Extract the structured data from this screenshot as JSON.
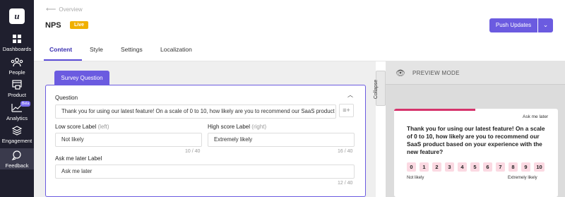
{
  "sidebar": {
    "logo": "u",
    "items": [
      {
        "label": "Dashboards",
        "icon": "grid-icon"
      },
      {
        "label": "People",
        "icon": "people-icon"
      },
      {
        "label": "Product",
        "icon": "product-icon"
      },
      {
        "label": "Analytics",
        "icon": "chart-icon",
        "badge": "Beta"
      },
      {
        "label": "Engagement",
        "icon": "layers-icon"
      },
      {
        "label": "Feedback",
        "icon": "chat-icon",
        "active": true
      }
    ]
  },
  "header": {
    "breadcrumb": "Overview",
    "title": "NPS",
    "status": "Live",
    "push_label": "Push Updates"
  },
  "tabs": [
    "Content",
    "Style",
    "Settings",
    "Localization"
  ],
  "editor": {
    "section_tab": "Survey Question",
    "question_label": "Question",
    "question_value": "Thank you for using our latest feature! On a scale of 0 to 10, how likely are you to recommend our SaaS product based on your experience with the new feature?",
    "low_label": "Low score Label",
    "low_hint": "(left)",
    "low_value": "Not likely",
    "low_count": "10 / 40",
    "high_label": "High score Label",
    "high_hint": "(right)",
    "high_value": "Extremely likely",
    "high_count": "16 / 40",
    "ask_label": "Ask me later Label",
    "ask_value": "Ask me later",
    "ask_count": "12 / 40",
    "collapse_label": "Collapse"
  },
  "preview": {
    "mode_label": "PREVIEW MODE",
    "ask_later": "Ask me later",
    "question_line1": "Thank you for using our latest feature! On a scale",
    "question_line2": "of 0 to 10, how likely are you to recommend our",
    "question_line3": "SaaS product based on your experience with the",
    "question_line4": "new feature?",
    "scale": [
      "0",
      "1",
      "2",
      "3",
      "4",
      "5",
      "6",
      "7",
      "8",
      "9",
      "10"
    ],
    "low": "Not likely",
    "high": "Extremely likely"
  },
  "colors": {
    "accent": "#6b5be0",
    "live": "#f0b000",
    "sidebar": "#1f1f2e",
    "scale_bg": "#fbd9e2",
    "progress": "#d6336c"
  }
}
